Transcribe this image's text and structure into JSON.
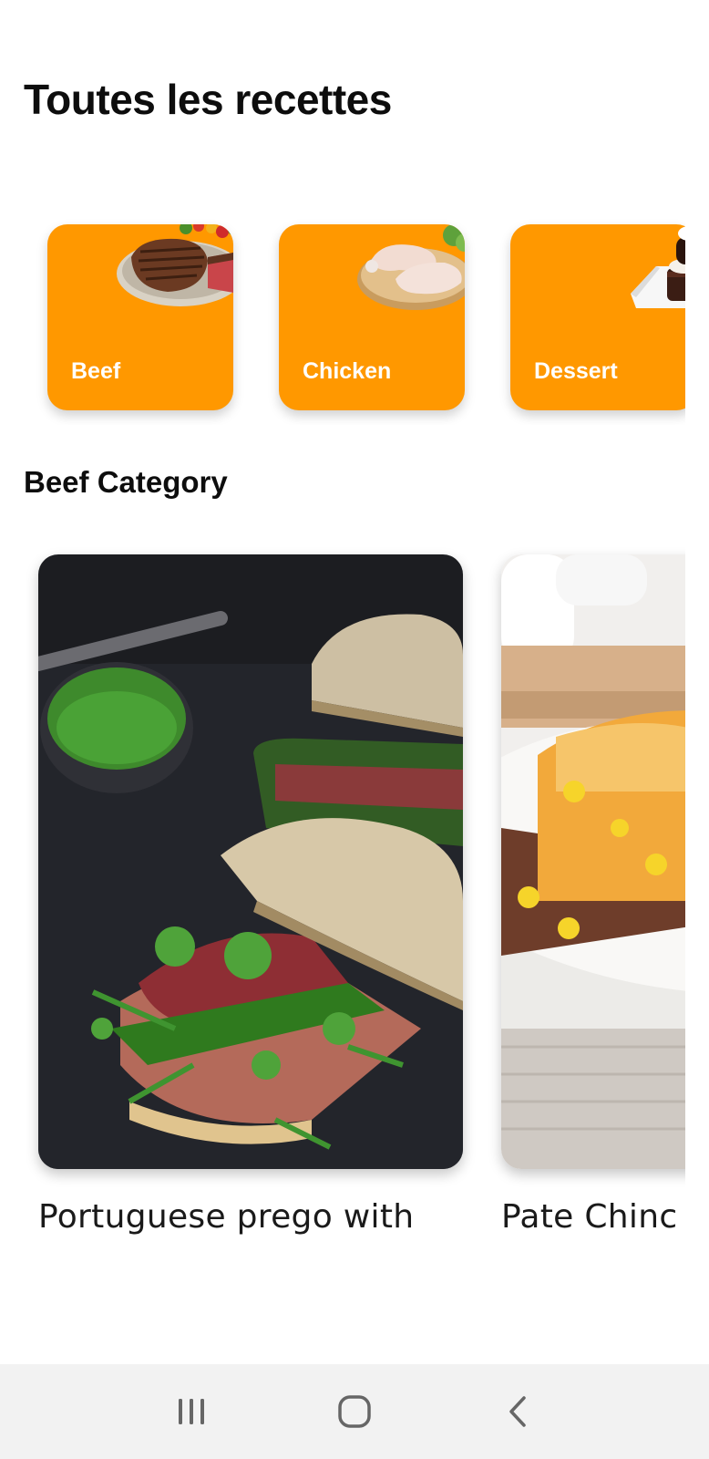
{
  "header": {
    "title": "Toutes les recettes"
  },
  "categories": [
    {
      "label": "Beef",
      "image": "grilled-steak-plate"
    },
    {
      "label": "Chicken",
      "image": "raw-chicken-legs-board"
    },
    {
      "label": "Dessert",
      "image": "chocolate-brownie-cream"
    }
  ],
  "section": {
    "title": "Beef Category"
  },
  "recipes": [
    {
      "title": "Portuguese prego with",
      "image": "steak-sandwich-green-sauce"
    },
    {
      "title": "Pate Chinc",
      "image": "shepherds-pie-plate"
    }
  ],
  "navbar": {
    "recent_icon": "recent-apps-icon",
    "home_icon": "home-icon",
    "back_icon": "back-icon"
  },
  "colors": {
    "accent": "#ff9800",
    "navbar": "#f2f2f2"
  }
}
